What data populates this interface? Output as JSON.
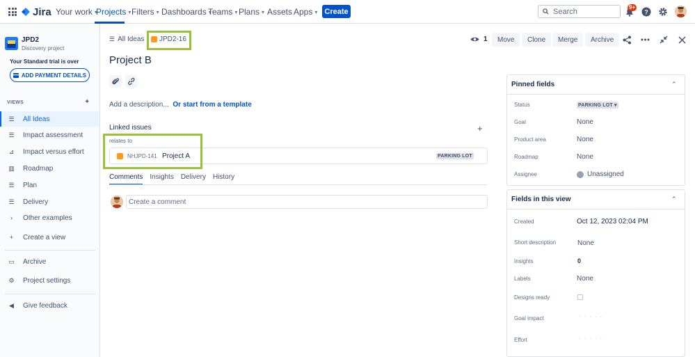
{
  "topnav": {
    "logo_text": "Jira",
    "items": [
      {
        "label": "Your work",
        "chevron": true
      },
      {
        "label": "Projects",
        "chevron": true
      },
      {
        "label": "Filters",
        "chevron": true
      },
      {
        "label": "Dashboards",
        "chevron": true
      },
      {
        "label": "Teams",
        "chevron": true
      },
      {
        "label": "Plans",
        "chevron": true
      },
      {
        "label": "Assets",
        "chevron": false
      },
      {
        "label": "Apps",
        "chevron": true
      }
    ],
    "create_label": "Create",
    "search_placeholder": "Search",
    "notification_badge": "9+",
    "accent_color": "#0052cc"
  },
  "sidebar": {
    "project_name": "JPD2",
    "project_type": "Discovery project",
    "trial_text": "Your Standard trial is over",
    "payment_button": "ADD PAYMENT DETAILS",
    "views_label": "VIEWS",
    "views": [
      {
        "label": "All Ideas",
        "icon": "list-icon",
        "active": true
      },
      {
        "label": "Impact assessment",
        "icon": "list-icon"
      },
      {
        "label": "Impact versus effort",
        "icon": "matrix-icon"
      },
      {
        "label": "Roadmap",
        "icon": "board-icon"
      },
      {
        "label": "Plan",
        "icon": "list-icon"
      },
      {
        "label": "Delivery",
        "icon": "list-icon"
      },
      {
        "label": "Other examples",
        "icon": "chevron-right-icon"
      }
    ],
    "create_view": "Create a view",
    "archive": "Archive",
    "project_settings": "Project settings",
    "give_feedback": "Give feedback"
  },
  "issue": {
    "breadcrumb_all": "All Ideas",
    "key": "JPD2-16",
    "watchers": "1",
    "actions": [
      "Move",
      "Clone",
      "Merge",
      "Archive"
    ],
    "title": "Project B",
    "description_prompt": "Add a description...",
    "template_link": "Or start from a template",
    "linked_issues_header": "Linked issues",
    "relation": "relates to",
    "linked": {
      "key": "NHJPD-141",
      "name": "Project A",
      "status": "PARKING LOT"
    },
    "tabs": [
      "Comments",
      "Insights",
      "Delivery",
      "History"
    ],
    "comment_placeholder": "Create a comment"
  },
  "pinned": {
    "header": "Pinned fields",
    "status_label": "Status",
    "status_value": "PARKING LOT",
    "fields": [
      {
        "label": "Goal",
        "value": "None"
      },
      {
        "label": "Product area",
        "value": "None"
      },
      {
        "label": "Roadmap",
        "value": "None"
      }
    ],
    "assignee_label": "Assignee",
    "assignee_value": "Unassigned"
  },
  "view_fields": {
    "header": "Fields in this view",
    "created_label": "Created",
    "created_value": "Oct 12, 2023 02:04 PM",
    "short_desc_label": "Short description",
    "short_desc_value": "None",
    "insights_label": "Insights",
    "insights_value": "0",
    "labels_label": "Labels",
    "labels_value": "None",
    "designs_label": "Designs ready",
    "goal_impact_label": "Goal impact",
    "effort_label": "Effort"
  }
}
